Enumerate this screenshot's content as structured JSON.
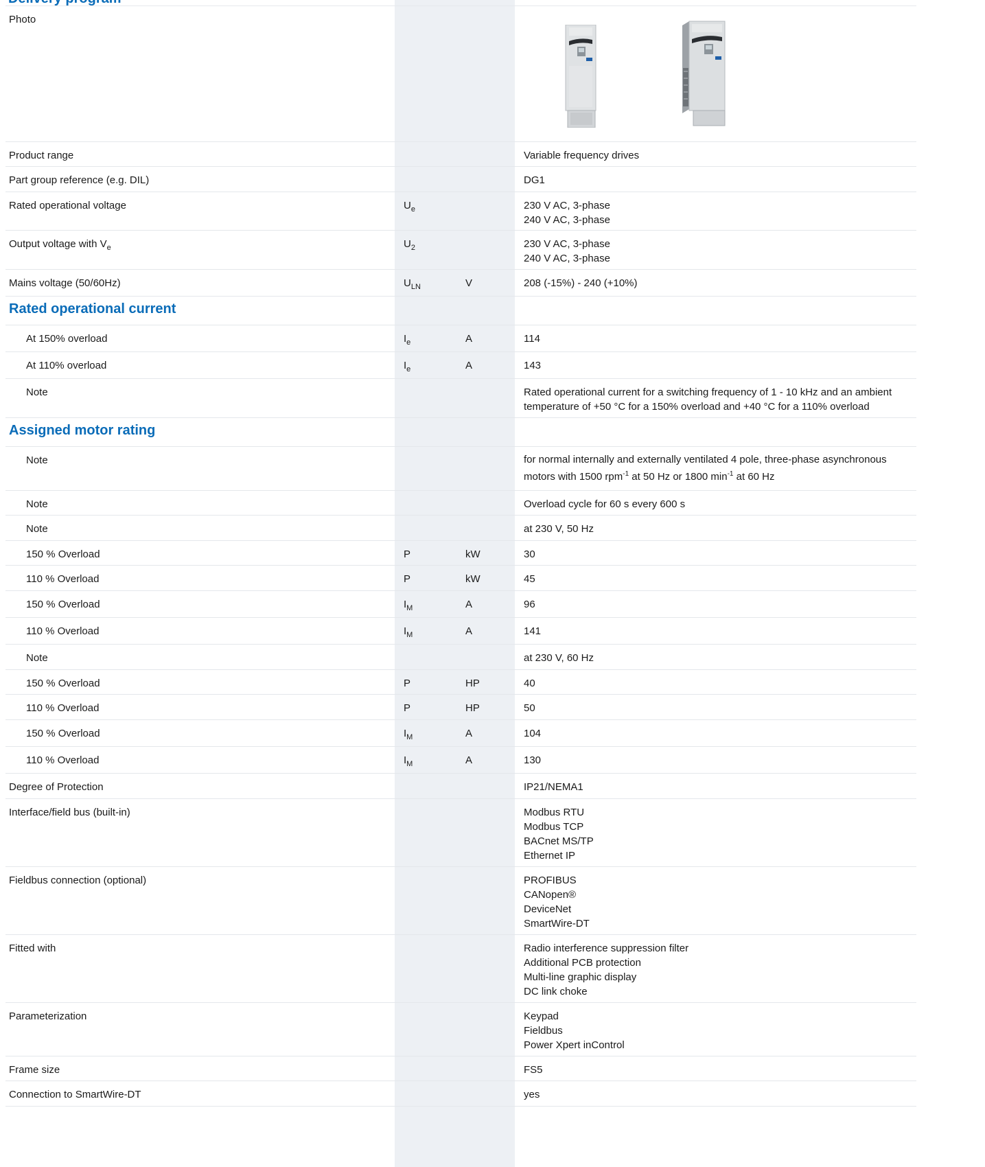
{
  "page_title": "Delivery program",
  "rows": {
    "photo": {
      "label": "Photo"
    },
    "product_range": {
      "label": "Product range",
      "value": "Variable frequency drives"
    },
    "part_group": {
      "label": "Part group reference (e.g. DIL)",
      "value": "DG1"
    },
    "rated_voltage": {
      "label": "Rated operational voltage",
      "sym": "U",
      "sym_sub": "e",
      "value": "230 V AC, 3-phase\n240 V AC, 3-phase"
    },
    "output_voltage": {
      "label": "Output voltage with V",
      "label_sub": "e",
      "sym": "U",
      "sym_sub": "2",
      "value": "230 V AC, 3-phase\n240 V AC, 3-phase"
    },
    "mains_voltage": {
      "label": "Mains voltage (50/60Hz)",
      "sym": "U",
      "sym_sub": "LN",
      "unit": "V",
      "value": "208 (-15%) - 240 (+10%)"
    },
    "sec_current": {
      "label": "Rated operational current"
    },
    "cur_150": {
      "label": "At 150% overload",
      "sym": "I",
      "sym_sub": "e",
      "unit": "A",
      "value": "114"
    },
    "cur_110": {
      "label": "At 110% overload",
      "sym": "I",
      "sym_sub": "e",
      "unit": "A",
      "value": "143"
    },
    "cur_note": {
      "label": "Note",
      "value": "Rated operational current for a switching frequency of 1 - 10 kHz and an ambient\ntemperature of +50 °C for a 150% overload and +40 °C for a 110% overload"
    },
    "sec_motor": {
      "label": "Assigned motor rating"
    },
    "motor_note1": {
      "label": "Note",
      "v1": "for normal internally and externally ventilated 4 pole, three-phase asynchronous",
      "v2a": "motors with 1500 rpm",
      "sup1": "-1",
      "v2b": " at 50 Hz or 1800 min",
      "sup2": "-1",
      "v2c": " at 60 Hz"
    },
    "motor_note2": {
      "label": "Note",
      "value": "Overload cycle for 60 s every 600 s"
    },
    "motor_note3": {
      "label": "Note",
      "value": "at 230 V, 50 Hz"
    },
    "p50_150": {
      "label": "150 % Overload",
      "sym": "P",
      "unit": "kW",
      "value": "30"
    },
    "p50_110": {
      "label": "110 % Overload",
      "sym": "P",
      "unit": "kW",
      "value": "45"
    },
    "i50_150": {
      "label": "150 % Overload",
      "sym": "I",
      "sym_sub": "M",
      "unit": "A",
      "value": "96"
    },
    "i50_110": {
      "label": "110 % Overload",
      "sym": "I",
      "sym_sub": "M",
      "unit": "A",
      "value": "141"
    },
    "motor_note4": {
      "label": "Note",
      "value": "at 230 V, 60 Hz"
    },
    "p60_150": {
      "label": "150 % Overload",
      "sym": "P",
      "unit": "HP",
      "value": "40"
    },
    "p60_110": {
      "label": "110 % Overload",
      "sym": "P",
      "unit": "HP",
      "value": "50"
    },
    "i60_150": {
      "label": "150 % Overload",
      "sym": "I",
      "sym_sub": "M",
      "unit": "A",
      "value": "104"
    },
    "i60_110": {
      "label": "110 % Overload",
      "sym": "I",
      "sym_sub": "M",
      "unit": "A",
      "value": "130"
    },
    "protection": {
      "label": "Degree of Protection",
      "value": "IP21/NEMA1"
    },
    "interface": {
      "label": "Interface/field bus (built-in)",
      "value": "Modbus RTU\nModbus TCP\nBACnet MS/TP\nEthernet IP"
    },
    "fieldbus_opt": {
      "label": "Fieldbus connection (optional)",
      "value": "PROFIBUS\nCANopen®\nDeviceNet\nSmartWire-DT"
    },
    "fitted": {
      "label": "Fitted with",
      "value": "Radio interference suppression filter\nAdditional PCB protection\nMulti-line graphic display\nDC link choke"
    },
    "parameterization": {
      "label": "Parameterization",
      "value": "Keypad\nFieldbus\nPower Xpert inControl"
    },
    "frame": {
      "label": "Frame size",
      "value": "FS5"
    },
    "smartwire": {
      "label": "Connection to SmartWire-DT",
      "value": "yes"
    }
  },
  "colors": {
    "heading": "#0a6cb8",
    "symbol_column": "#edf0f4",
    "rule": "#e4e7eb"
  }
}
